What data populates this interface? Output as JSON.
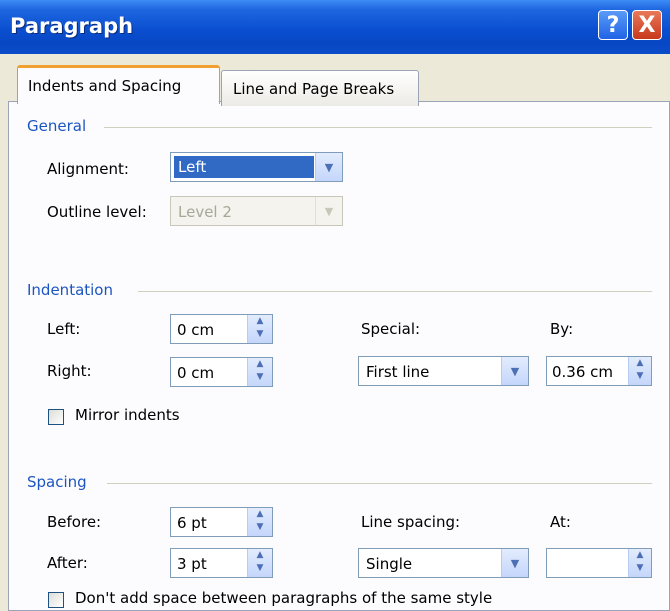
{
  "window": {
    "title": "Paragraph",
    "help_label": "?",
    "close_label": "X"
  },
  "tabs": [
    {
      "label": "Indents and Spacing"
    },
    {
      "label": "Line and Page Breaks"
    }
  ],
  "general": {
    "heading": "General",
    "alignment_label": "Alignment:",
    "alignment_value": "Left",
    "outline_label": "Outline level:",
    "outline_value": "Level 2"
  },
  "indentation": {
    "heading": "Indentation",
    "left_label": "Left:",
    "left_value": "0 cm",
    "right_label": "Right:",
    "right_value": "0 cm",
    "special_label": "Special:",
    "special_value": "First line",
    "by_label": "By:",
    "by_value": "0.36 cm",
    "mirror_label": "Mirror indents"
  },
  "spacing": {
    "heading": "Spacing",
    "before_label": "Before:",
    "before_value": "6 pt",
    "after_label": "After:",
    "after_value": "3 pt",
    "line_spacing_label": "Line spacing:",
    "line_spacing_value": "Single",
    "at_label": "At:",
    "at_value": "",
    "dont_add_label": "Don't add space between paragraphs of the same style"
  }
}
